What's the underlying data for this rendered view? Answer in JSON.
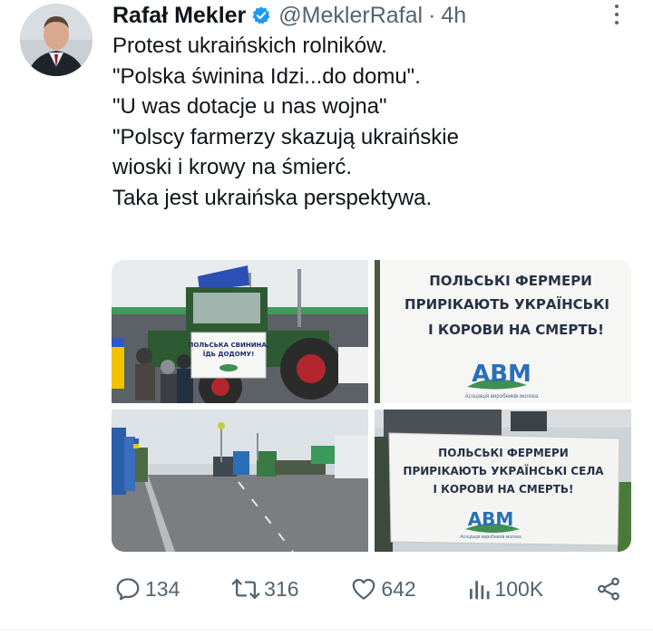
{
  "author": {
    "name": "Rafał Mekler",
    "handle": "@MeklerRafal",
    "separator": "·",
    "time": "4h"
  },
  "tweet": {
    "lines": [
      "Protest ukraińskich rolników.",
      "\"Polska świnina Idzi...do domu\".",
      "\"U was dotacje u nas wojna\"",
      "\"Polscy farmerzy skazują ukraińskie",
      "wioski i krowy na śmierć.",
      "Taka jest ukraińska perspektywa."
    ]
  },
  "media": {
    "image1_sign": [
      "ПОЛЬСЬКА СВИНИНА,",
      "ЇДЬ ДОДОМУ!"
    ],
    "image2_banner": [
      "ПОЛЬСЬКІ ФЕРМЕРИ",
      "ПРИРІКАЮТЬ УКРАЇНСЬКІ",
      "І КОРОВИ НА СМЕРТЬ!"
    ],
    "image2_logo": "АВМ",
    "image2_logo_caption": "Асоціація виробників молока",
    "image4_banner": [
      "ПОЛЬСЬКІ ФЕРМЕРИ",
      "ПРИРІКАЮТЬ УКРАЇНСЬКІ СЕЛА",
      "І КОРОВИ НА СМЕРТЬ!"
    ],
    "image4_logo": "АВМ",
    "image4_logo_caption": "Асоціація виробників молока"
  },
  "actions": {
    "replies": "134",
    "retweets": "316",
    "likes": "642",
    "views": "100K"
  },
  "colors": {
    "verified": "#1d9bf0",
    "secondary_text": "#536471",
    "text": "#0f1419"
  },
  "icons": {
    "verified": "verified-badge-icon",
    "more": "more-options-icon",
    "reply": "reply-icon",
    "retweet": "retweet-icon",
    "like": "like-icon",
    "views": "views-icon",
    "share": "share-icon"
  }
}
